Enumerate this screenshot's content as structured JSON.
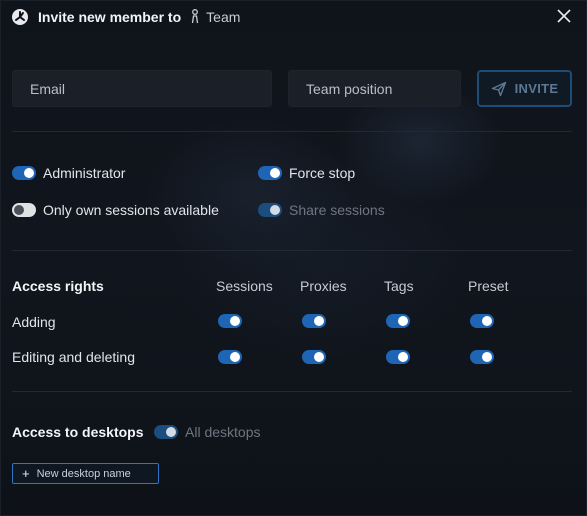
{
  "header": {
    "title": "Invite new member to",
    "team_name": "Team",
    "logo_icon": "app-logo-icon",
    "team_icon": "team-figure-icon",
    "close_icon": "close-icon"
  },
  "invite_form": {
    "email_placeholder": "Email",
    "position_placeholder": "Team position",
    "invite_label": "INVITE",
    "invite_icon": "send-plane-icon"
  },
  "roles": {
    "administrator": {
      "label": "Administrator",
      "on": true
    },
    "force_stop": {
      "label": "Force stop",
      "on": true
    },
    "own_sessions": {
      "label": "Only own sessions available",
      "on": false
    },
    "share_sessions": {
      "label": "Share sessions",
      "on": true,
      "disabled": true
    }
  },
  "access_rights": {
    "title": "Access rights",
    "columns": [
      "Sessions",
      "Proxies",
      "Tags",
      "Preset"
    ],
    "rows": [
      {
        "label": "Adding",
        "values": [
          true,
          true,
          true,
          true
        ]
      },
      {
        "label": "Editing and deleting",
        "values": [
          true,
          true,
          true,
          true
        ]
      }
    ]
  },
  "desktops": {
    "title": "Access to desktops",
    "all_label": "All desktops",
    "all_on": true,
    "add_label": "New desktop name"
  },
  "colors": {
    "accent": "#1e66b5",
    "background": "#0f131a",
    "input_bg": "#1b2028",
    "button_border": "#1d4c76"
  }
}
